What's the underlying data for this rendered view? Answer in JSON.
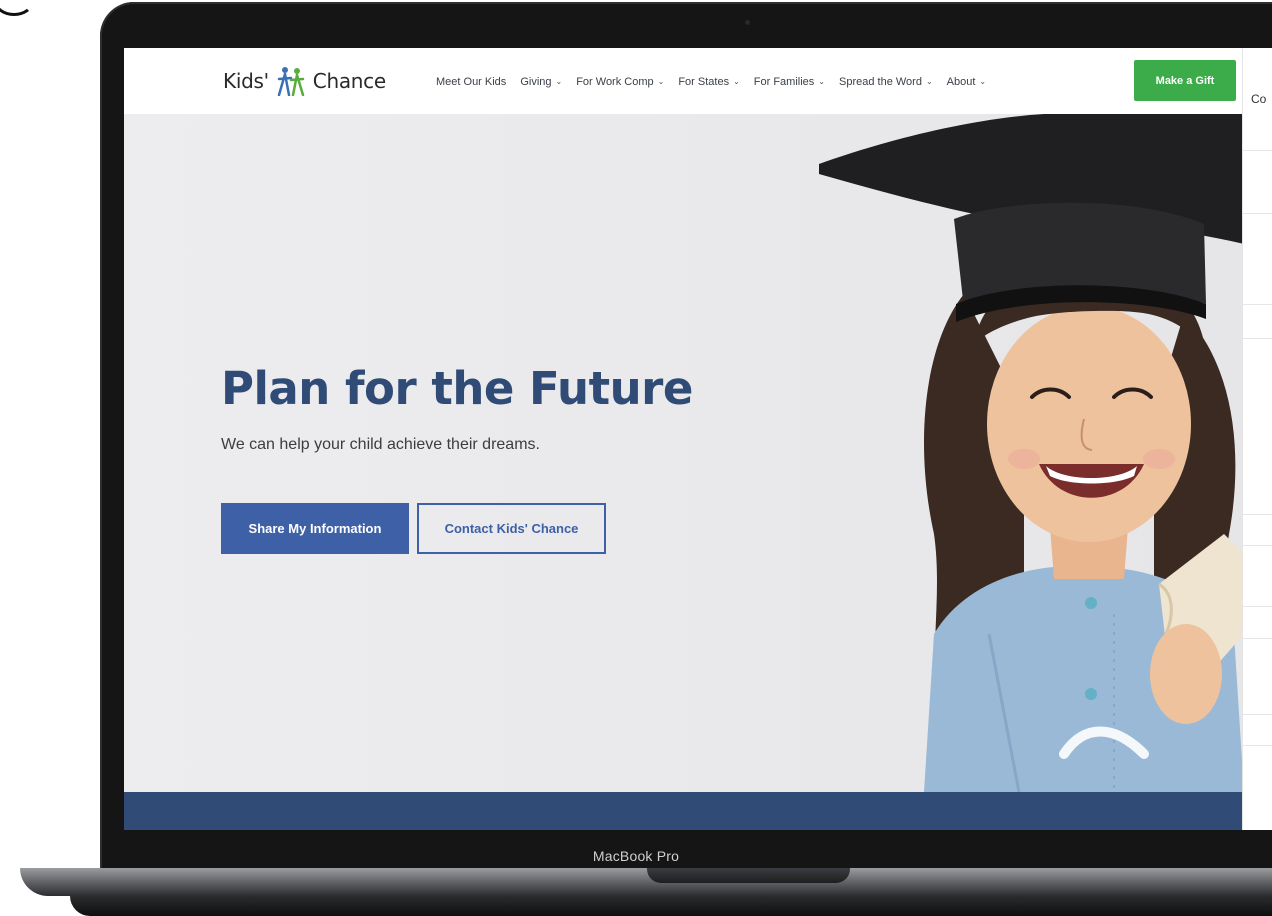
{
  "device": {
    "label": "MacBook Pro"
  },
  "nav": {
    "logo_left": "Kids'",
    "logo_right": "Chance",
    "menu": [
      {
        "label": "Meet Our Kids",
        "dropdown": false
      },
      {
        "label": "Giving",
        "dropdown": true
      },
      {
        "label": "For Work Comp",
        "dropdown": true
      },
      {
        "label": "For States",
        "dropdown": true
      },
      {
        "label": "For Families",
        "dropdown": true
      },
      {
        "label": "Spread the Word",
        "dropdown": true
      },
      {
        "label": "About",
        "dropdown": true
      }
    ],
    "gift_button": "Make a Gift"
  },
  "side_panel": {
    "text": "Co"
  },
  "hero": {
    "title": "Plan for the Future",
    "subtitle": "We can help your child achieve their dreams.",
    "primary_button": "Share My Information",
    "secondary_button": "Contact Kids' Chance",
    "image": "smiling-girl-graduation-cap-photo"
  },
  "colors": {
    "brand_blue": "#2f4b76",
    "button_blue": "#3d60a6",
    "gift_green": "#3cac4a",
    "logo_blue": "#3d6fb6",
    "logo_green": "#5aab3e"
  }
}
